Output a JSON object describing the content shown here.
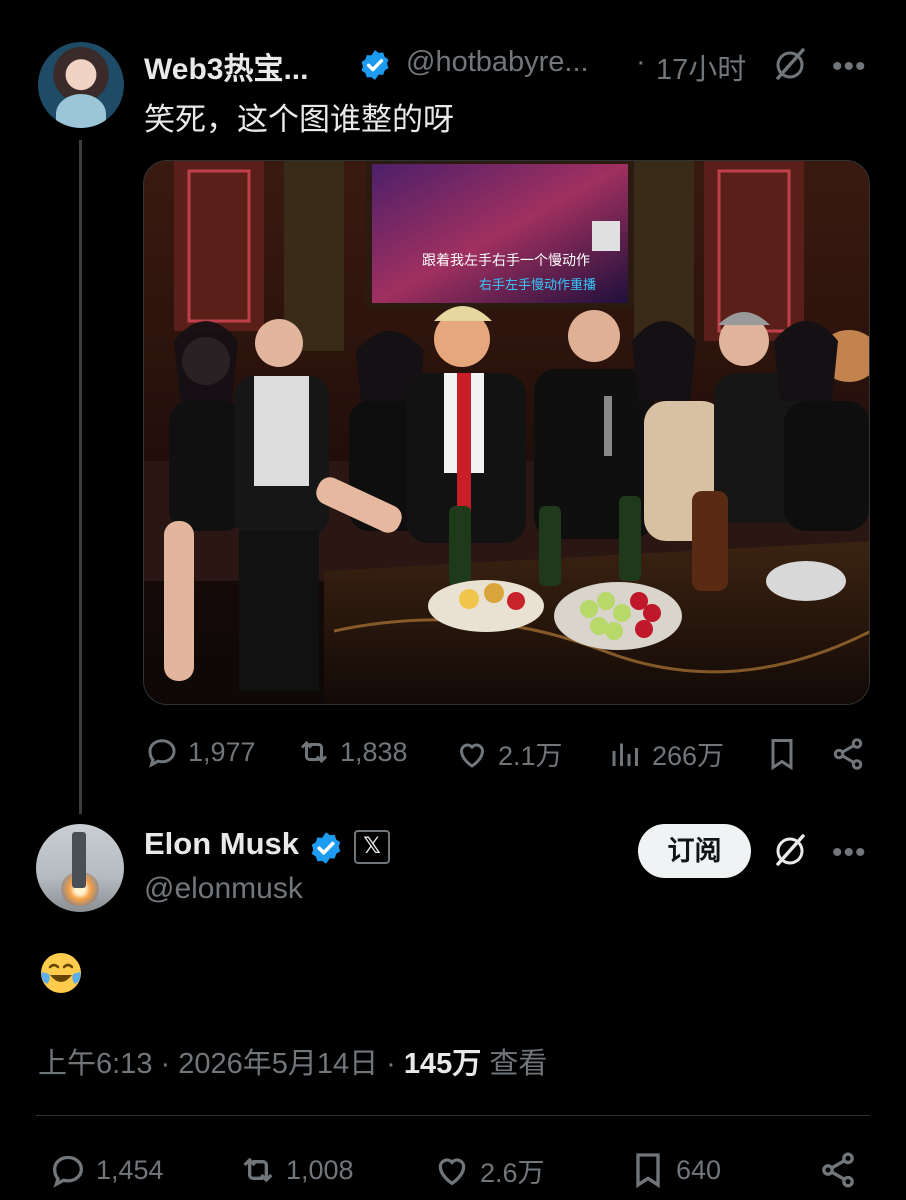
{
  "parent": {
    "display_name": "Web3热宝...",
    "handle": "@hotbabyre...",
    "separator": "·",
    "time": "17小时",
    "text": "笑死，这个图谁整的呀",
    "photo_caption_top": "跟着我左手右手一个慢动作",
    "photo_caption_bottom": "右手左手慢动作重播",
    "actions": {
      "replies": "1,977",
      "retweets": "1,838",
      "likes": "2.1万",
      "views": "266万"
    }
  },
  "tweet": {
    "display_name": "Elon Musk",
    "handle": "@elonmusk",
    "affiliate_badge": "𝕏",
    "subscribe_label": "订阅",
    "emoji": "😂",
    "time": "上午6:13 · 2026年5月14日 · ",
    "views_count": "145万",
    "views_label": "查看",
    "actions": {
      "replies": "1,454",
      "retweets": "1,008",
      "likes": "2.6万",
      "bookmarks": "640"
    }
  },
  "colors": {
    "background": "#000000",
    "text_primary": "#e7e9ea",
    "text_secondary": "#71767b",
    "verified": "#1d9bf0",
    "button_bg": "#eff3f4"
  },
  "icons": [
    "verified-icon",
    "grok-icon",
    "more-icon",
    "reply-icon",
    "retweet-icon",
    "like-icon",
    "views-icon",
    "bookmark-icon",
    "share-icon"
  ]
}
